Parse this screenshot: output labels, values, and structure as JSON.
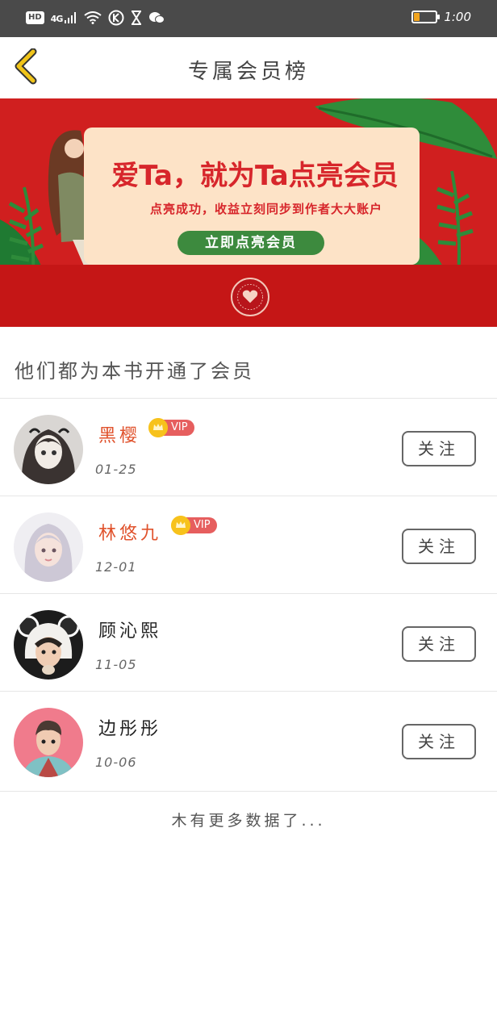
{
  "status_bar": {
    "network_label": "HD",
    "signal_label": "4G",
    "time": "1:00",
    "battery_level": 0.25,
    "icons": [
      "hd-icon",
      "signal-icon",
      "wifi-icon",
      "k-icon",
      "hourglass-icon",
      "wechat-icon",
      "battery-icon"
    ]
  },
  "header": {
    "title": "专属会员榜",
    "back_icon": "chevron-left-icon"
  },
  "banner": {
    "headline": "爱Ta，就为Ta点亮会员",
    "subtext": "点亮成功，收益立刻同步到作者大大账户",
    "button_label": "立即点亮会员",
    "colors": {
      "background": "#d01f1f",
      "card": "#fde3c7",
      "button": "#3d8a3e",
      "text": "#d7262b"
    }
  },
  "section": {
    "title": "他们都为本书开通了会员"
  },
  "members": [
    {
      "name": "黑樱",
      "date": "01-25",
      "vip": true,
      "vip_label": "VIP",
      "follow_label": "关注"
    },
    {
      "name": "林悠九",
      "date": "12-01",
      "vip": true,
      "vip_label": "VIP",
      "follow_label": "关注"
    },
    {
      "name": "顾沁熙",
      "date": "11-05",
      "vip": false,
      "follow_label": "关注"
    },
    {
      "name": "边彤彤",
      "date": "10-06",
      "vip": false,
      "follow_label": "关注"
    }
  ],
  "footer": {
    "no_more": "木有更多数据了..."
  },
  "colors": {
    "vip_name": "#e0522c",
    "vip_badge": "#e65e5e",
    "crown": "#f7c21c",
    "back_arrow": "#f0c419"
  }
}
